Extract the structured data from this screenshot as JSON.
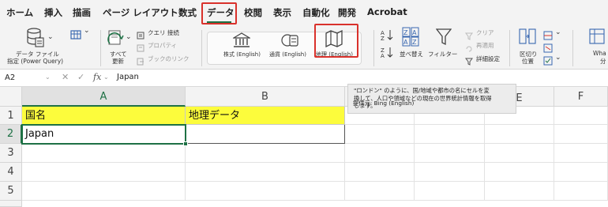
{
  "tabs": [
    "ホーム",
    "挿入",
    "描画",
    "ページ レイアウト",
    "数式",
    "データ",
    "校閲",
    "表示",
    "自動化",
    "開発",
    "Acrobat"
  ],
  "active_tab": "データ",
  "ribbon": {
    "get_data": "データ ファイル\n指定 (Power Query)",
    "get_data_l1": "データ ファイル",
    "get_data_l2": "指定 (Power Query)",
    "refresh_l1": "すべて",
    "refresh_l2": "更新",
    "queries": "クエリ  接続",
    "properties": "プロパティ",
    "book_links": "ブックのリンク",
    "stocks": "株式 (English)",
    "currencies": "通貨 (English)",
    "geography": "地理 (English)",
    "sort": "並べ替え",
    "filter": "フィルター",
    "clear": "クリア",
    "reapply": "再適用",
    "advanced": "詳細設定",
    "text_to_columns_l1": "区切り",
    "text_to_columns_l2": "位置",
    "whatif_partial": "Wha",
    "whatif_partial2": "分"
  },
  "tooltip": {
    "line1": "\"ロンドン\" のように、国/地域や都市の名にセルを変",
    "line2": "換して、人口や領域などの現在の世界統計情報を取得",
    "line3": "します。",
    "source": "提供元: Bing (English)"
  },
  "formula_bar": {
    "name_box": "A2",
    "value": "Japan",
    "fx": "fx"
  },
  "columns": [
    "A",
    "B",
    "C",
    "D",
    "E",
    "F"
  ],
  "rows": [
    "1",
    "2",
    "3",
    "4",
    "5"
  ],
  "cells": {
    "A1": "国名",
    "B1": "地理データ",
    "A2": "Japan"
  },
  "colors": {
    "accent": "#1e7145",
    "highlight": "#d9312b",
    "header_fill": "#fcfc3c"
  }
}
